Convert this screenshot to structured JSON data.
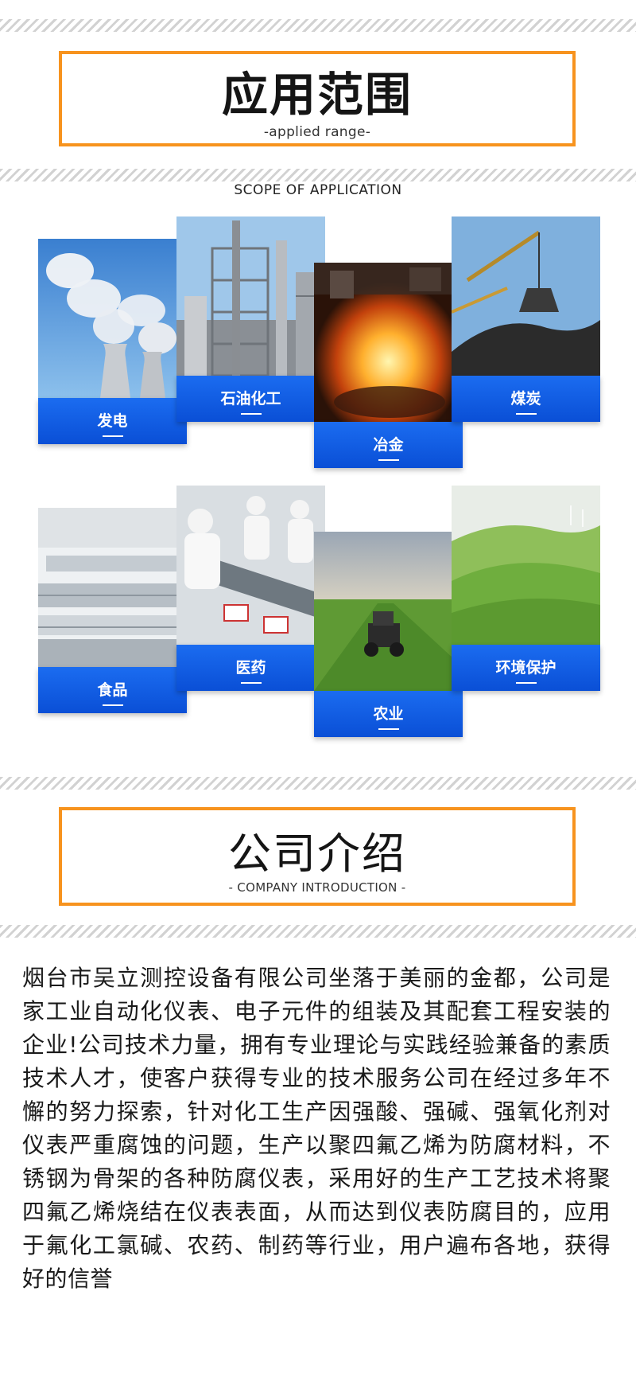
{
  "section1": {
    "title": "应用范围",
    "subtitle": "-applied range-",
    "scope_label": "SCOPE OF APPLICATION"
  },
  "applications": [
    {
      "label": "发电",
      "image": "cooling-towers"
    },
    {
      "label": "石油化工",
      "image": "refinery"
    },
    {
      "label": "冶金",
      "image": "steel-furnace"
    },
    {
      "label": "煤炭",
      "image": "coal-excavator"
    },
    {
      "label": "食品",
      "image": "food-production-line"
    },
    {
      "label": "医药",
      "image": "pharma-workers"
    },
    {
      "label": "农业",
      "image": "tractor-field"
    },
    {
      "label": "环境保护",
      "image": "green-hills"
    }
  ],
  "section2": {
    "title": "公司介绍",
    "subtitle": "- COMPANY INTRODUCTION -"
  },
  "intro_text": "烟台市吴立测控设备有限公司坐落于美丽的金都，公司是家工业自动化仪表、电子元件的组装及其配套工程安装的企业!公司技术力量，拥有专业理论与实践经验兼备的素质技术人才，使客户获得专业的技术服务公司在经过多年不懈的努力探索，针对化工生产因强酸、强碱、强氧化剂对仪表严重腐蚀的问题，生产以聚四氟乙烯为防腐材料，不锈钢为骨架的各种防腐仪表，采用好的生产工艺技术将聚四氟乙烯烧结在仪表表面，从而达到仪表防腐目的，应用于氟化工氯碱、农药、制药等行业，用户遍布各地，获得好的信誉",
  "colors": {
    "accent_orange": "#f7931e",
    "label_blue": "#0a4fd6"
  }
}
